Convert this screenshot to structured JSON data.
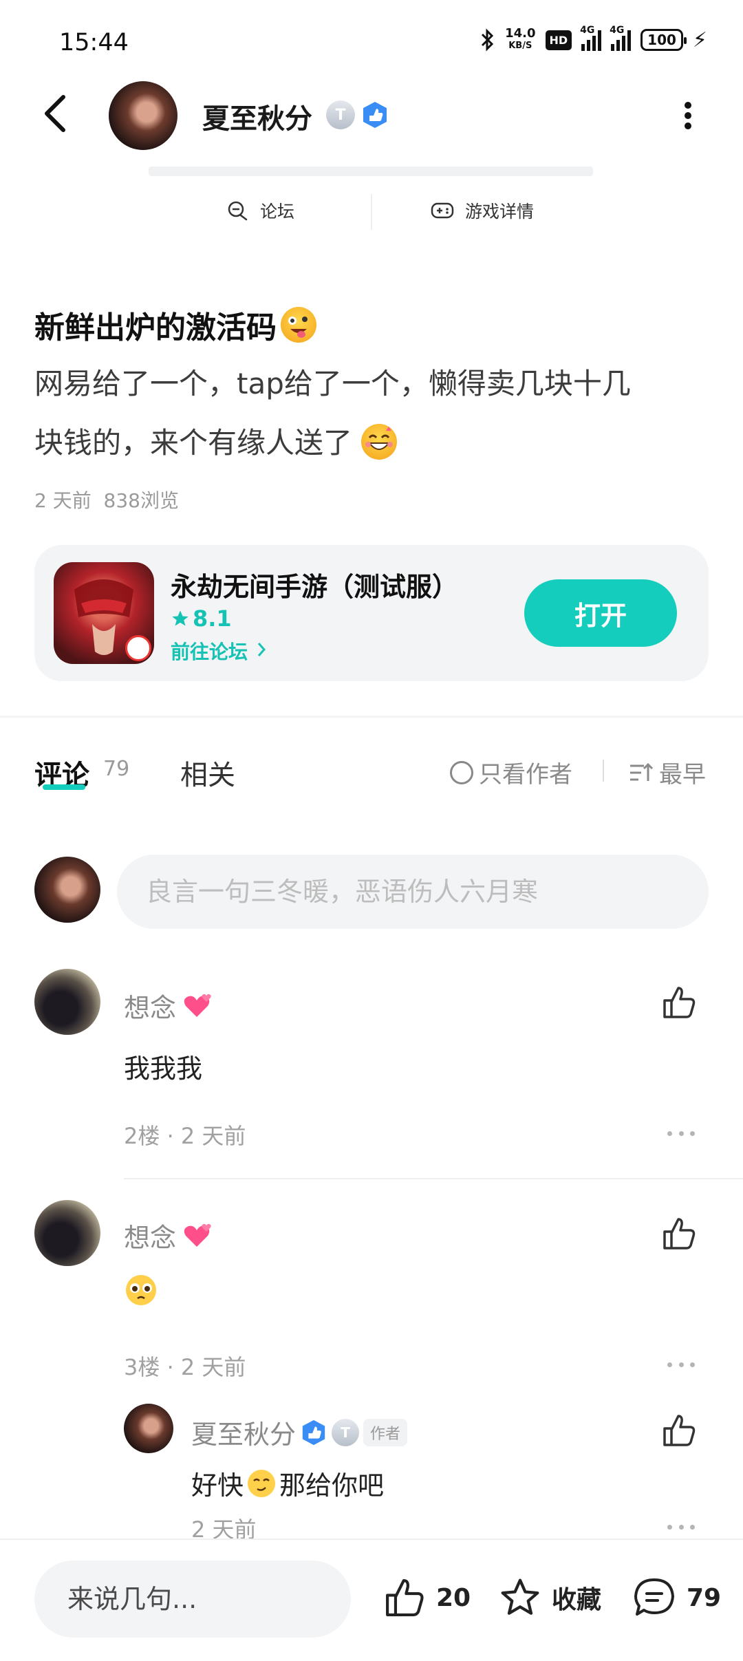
{
  "status_bar": {
    "time": "15:44",
    "net_speed_value": "14.0",
    "net_speed_unit": "KB/S",
    "hd_label": "HD",
    "network_1": "4G",
    "network_2": "4G",
    "battery": "100"
  },
  "header": {
    "author_name": "夏至秋分",
    "level_badge": "T",
    "tabs": [
      "论坛",
      "游戏详情"
    ]
  },
  "post": {
    "title": "新鲜出炉的激活码",
    "body_line_1": "网易给了一个，tap给了一个，懒得卖几块十几",
    "body_line_2": "块钱的，来个有缘人送了",
    "time_ago": "2 天前",
    "views": "838浏览"
  },
  "game_card": {
    "name": "永劫无间手游（测试服）",
    "score": "8.1",
    "forum_link": "前往论坛",
    "open_label": "打开"
  },
  "comments_header": {
    "tab_comments": "评论",
    "comment_count": "79",
    "tab_related": "相关",
    "filter_author": "只看作者",
    "sort_label": "最早"
  },
  "comment_input": {
    "placeholder": "良言一句三冬暖，恶语伤人六月寒"
  },
  "comments": [
    {
      "name": "想念",
      "text": "我我我",
      "meta": "2楼 · 2 天前"
    },
    {
      "name": "想念",
      "text": "",
      "meta": "3楼 · 2 天前"
    }
  ],
  "reply": {
    "name": "夏至秋分",
    "tag": "作者",
    "text_before": "好快",
    "text_after": "那给你吧",
    "time": "2 天前"
  },
  "bottom_bar": {
    "placeholder": "来说几句...",
    "likes": "20",
    "favorite_label": "收藏",
    "comments": "79"
  },
  "colors": {
    "accent": "#14CDBC",
    "text_primary": "#111111",
    "text_secondary": "#8A8A8A",
    "card_bg": "#F3F4F6"
  }
}
